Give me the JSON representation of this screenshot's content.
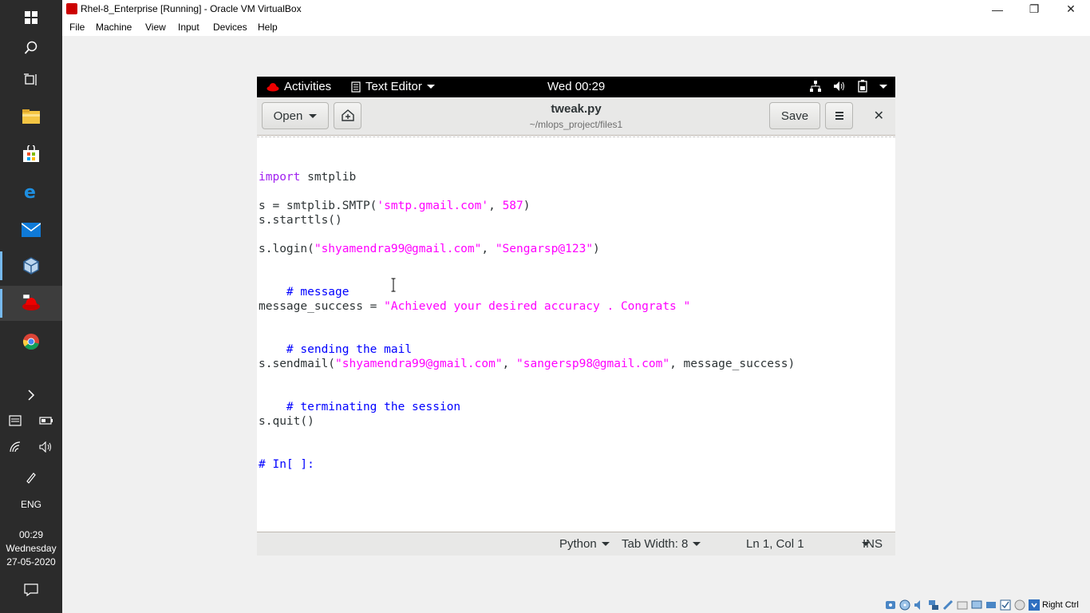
{
  "taskbar": {
    "time": "00:29",
    "day": "Wednesday",
    "date": "27-05-2020",
    "language": "ENG"
  },
  "window": {
    "title": "Rhel-8_Enterprise [Running] - Oracle VM VirtualBox",
    "menu": [
      "File",
      "Machine",
      "View",
      "Input",
      "Devices",
      "Help"
    ],
    "host_key": "Right Ctrl"
  },
  "gnome": {
    "activities": "Activities",
    "app_menu": "Text Editor",
    "clock": "Wed 00:29"
  },
  "editor_header": {
    "open_label": "Open",
    "file_name": "tweak.py",
    "file_path": "~/mlops_project/files1",
    "save_label": "Save"
  },
  "code": {
    "l1_kw": "import",
    "l1_rest": " smtplib",
    "l2_pre": "s = smtplib.SMTP(",
    "l2_str": "'smtp.gmail.com'",
    "l2_sep": ", ",
    "l2_num": "587",
    "l2_end": ")",
    "l3": "s.starttls()",
    "l4_pre": "s.login(",
    "l4_str1": "\"shyamendra99@gmail.com\"",
    "l4_sep": ", ",
    "l4_str2": "\"Sengarsp@123\"",
    "l4_end": ")",
    "l5_cmt": "    # message",
    "l6_pre": "message_success = ",
    "l6_str": "\"Achieved your desired accuracy . Congrats \"",
    "l7_cmt": "    # sending the mail",
    "l8_pre": "s.sendmail(",
    "l8_str1": "\"shyamendra99@gmail.com\"",
    "l8_sep": ", ",
    "l8_str2": "\"sangersp98@gmail.com\"",
    "l8_end": ", message_success)",
    "l9_cmt": "    # terminating the session",
    "l10": "s.quit()",
    "l11_cmt": "# In[ ]:"
  },
  "status": {
    "language": "Python",
    "tab_width": "Tab Width: 8",
    "position": "Ln 1, Col 1",
    "mode": "INS"
  }
}
